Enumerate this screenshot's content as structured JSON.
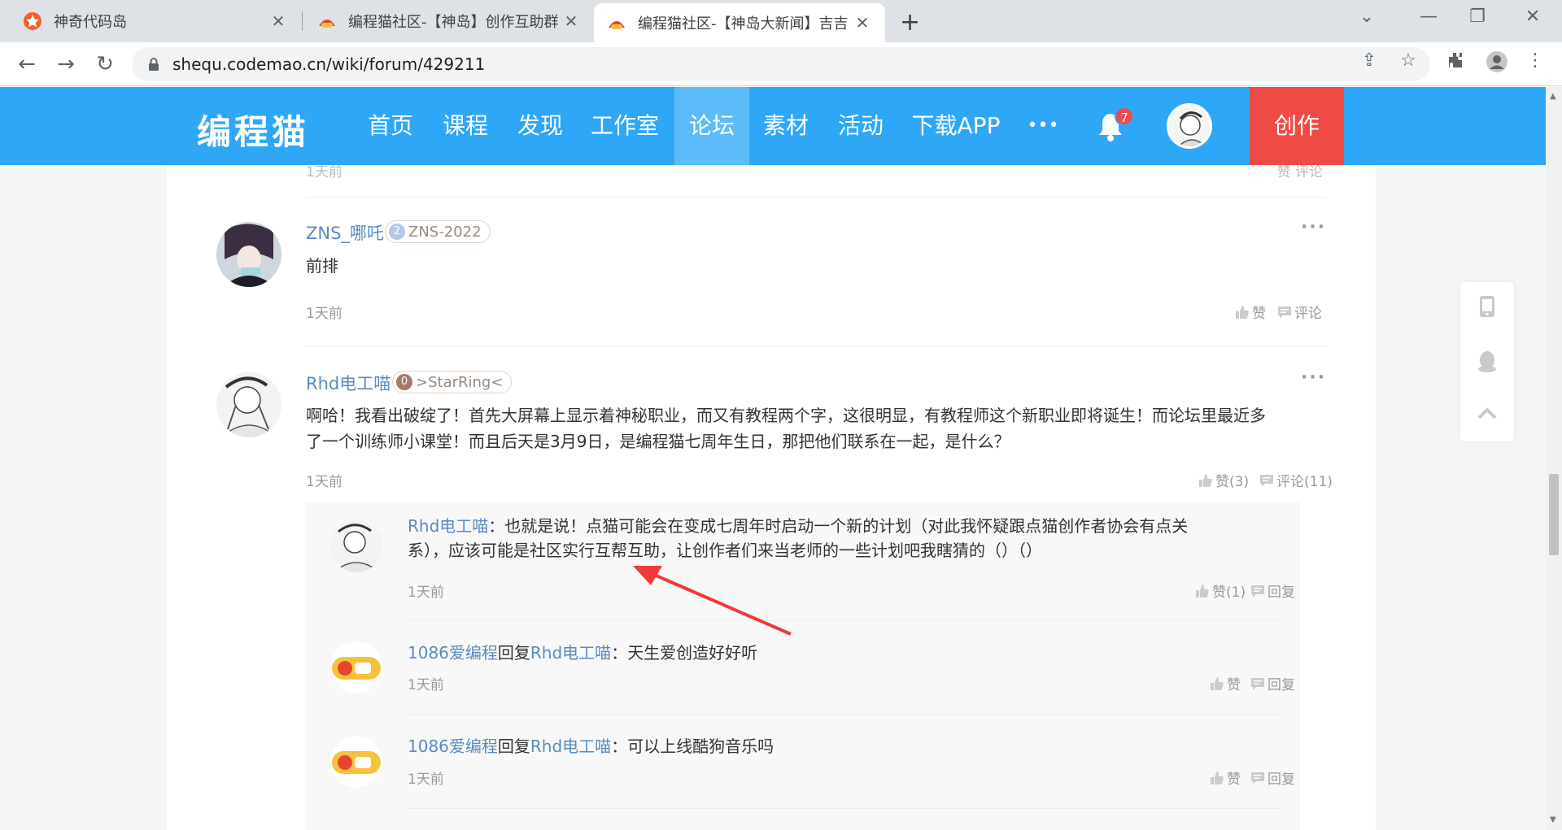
{
  "browser": {
    "tabs": [
      {
        "title": "神奇代码岛"
      },
      {
        "title": "编程猫社区-【神岛】创作互助群"
      },
      {
        "title": "编程猫社区-【神岛大新闻】吉吉"
      }
    ],
    "new_tab": "+",
    "url": "shequ.codemao.cn/wiki/forum/429211"
  },
  "site_nav": {
    "logo": "编程猫",
    "items": [
      "首页",
      "课程",
      "发现",
      "工作室",
      "论坛",
      "素材",
      "活动",
      "下载APP",
      "•••"
    ],
    "active_item": "论坛",
    "notification_count": "7",
    "create_label": "创作"
  },
  "comments": [
    {
      "user": "ZNS_哪吒",
      "badge_level": "2",
      "badge_text": "ZNS-2022",
      "text": "前排",
      "time": "1天前",
      "like_label": "赞",
      "comment_label": "评论"
    },
    {
      "user": "Rhd电工喵",
      "badge_level": "0",
      "badge_text": ">StarRing<",
      "text_line1": "啊哈！我看出破绽了！首先大屏幕上显示着神秘职业，而又有教程两个字，这很明显，有教程师这个新职业即将诞生！而论坛里最近多",
      "text_line2": "了一个训练师小课堂！而且后天是3月9日，是编程猫七周年生日，那把他们联系在一起，是什么？",
      "time": "1天前",
      "like_label": "赞(3)",
      "comment_label": "评论(11)"
    }
  ],
  "replies": [
    {
      "user": "Rhd电工喵",
      "sep": "：",
      "text_line1": "也就是说！点猫可能会在变成七周年时启动一个新的计划（对此我怀疑跟点猫创作者协会有点关",
      "text_line2": "系），应该可能是社区实行互帮互助，让创作者们来当老师的一些计划吧我瞎猜的（）（）",
      "time": "1天前",
      "like_label": "赞(1)",
      "reply_label": "回复"
    },
    {
      "user": "1086爱编程",
      "reply_word": "回复",
      "target": "Rhd电工喵",
      "sep": "：",
      "text": "天生爱创造好好听",
      "time": "1天前",
      "like_label": "赞",
      "reply_label": "回复"
    },
    {
      "user": "1086爱编程",
      "reply_word": "回复",
      "target": "Rhd电工喵",
      "sep": "：",
      "text": "可以上线酷狗音乐吗",
      "time": "1天前",
      "like_label": "赞",
      "reply_label": "回复"
    }
  ],
  "top_stub": {
    "time": "1天前",
    "actions": "赞  评论"
  },
  "colors": {
    "nav_blue": "#2ea7f7",
    "create_red": "#f04a44",
    "username_blue": "#5a8bc0",
    "annotation_arrow": "#f03a3a"
  }
}
